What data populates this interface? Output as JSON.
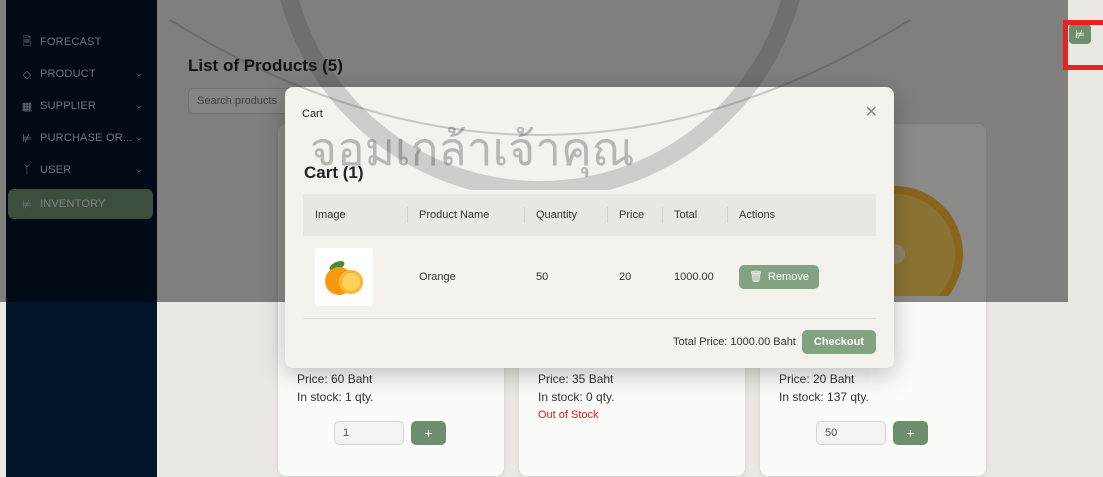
{
  "sidebar": {
    "items": [
      {
        "label": "FORECAST",
        "icon": "file-icon"
      },
      {
        "label": "PRODUCT",
        "icon": "tag-icon"
      },
      {
        "label": "SUPPLIER",
        "icon": "supplier-icon"
      },
      {
        "label": "PURCHASE OR...",
        "icon": "cart-icon"
      },
      {
        "label": "USER",
        "icon": "user-icon"
      },
      {
        "label": "INVENTORY",
        "icon": "cart-icon"
      }
    ]
  },
  "page": {
    "title": "List of Products (5)",
    "search_placeholder": "Search products"
  },
  "products": [
    {
      "price": "Price: 60 Baht",
      "stock": "In stock: 1 qty.",
      "qty": "1"
    },
    {
      "price": "Price: 35 Baht",
      "stock": "In stock: 0 qty.",
      "status": "Out of Stock"
    },
    {
      "price": "Price: 20 Baht",
      "stock": "In stock: 137 qty.",
      "qty": "50"
    }
  ],
  "modal": {
    "title": "Cart",
    "heading": "Cart (1)",
    "columns": [
      "Image",
      "Product Name",
      "Quantity",
      "Price",
      "Total",
      "Actions"
    ],
    "rows": [
      {
        "name": "Orange",
        "quantity": "50",
        "price": "20",
        "total": "1000.00",
        "action": "Remove"
      }
    ],
    "total_price": "Total Price: 1000.00 Baht",
    "checkout_label": "Checkout"
  },
  "watermark": {
    "text": "จอมเกล้าเจ้าคุณ"
  },
  "colors": {
    "sidebar": "#001529",
    "accent": "#6e8e6d",
    "danger": "#d02020",
    "highlight": "#e6231f"
  }
}
